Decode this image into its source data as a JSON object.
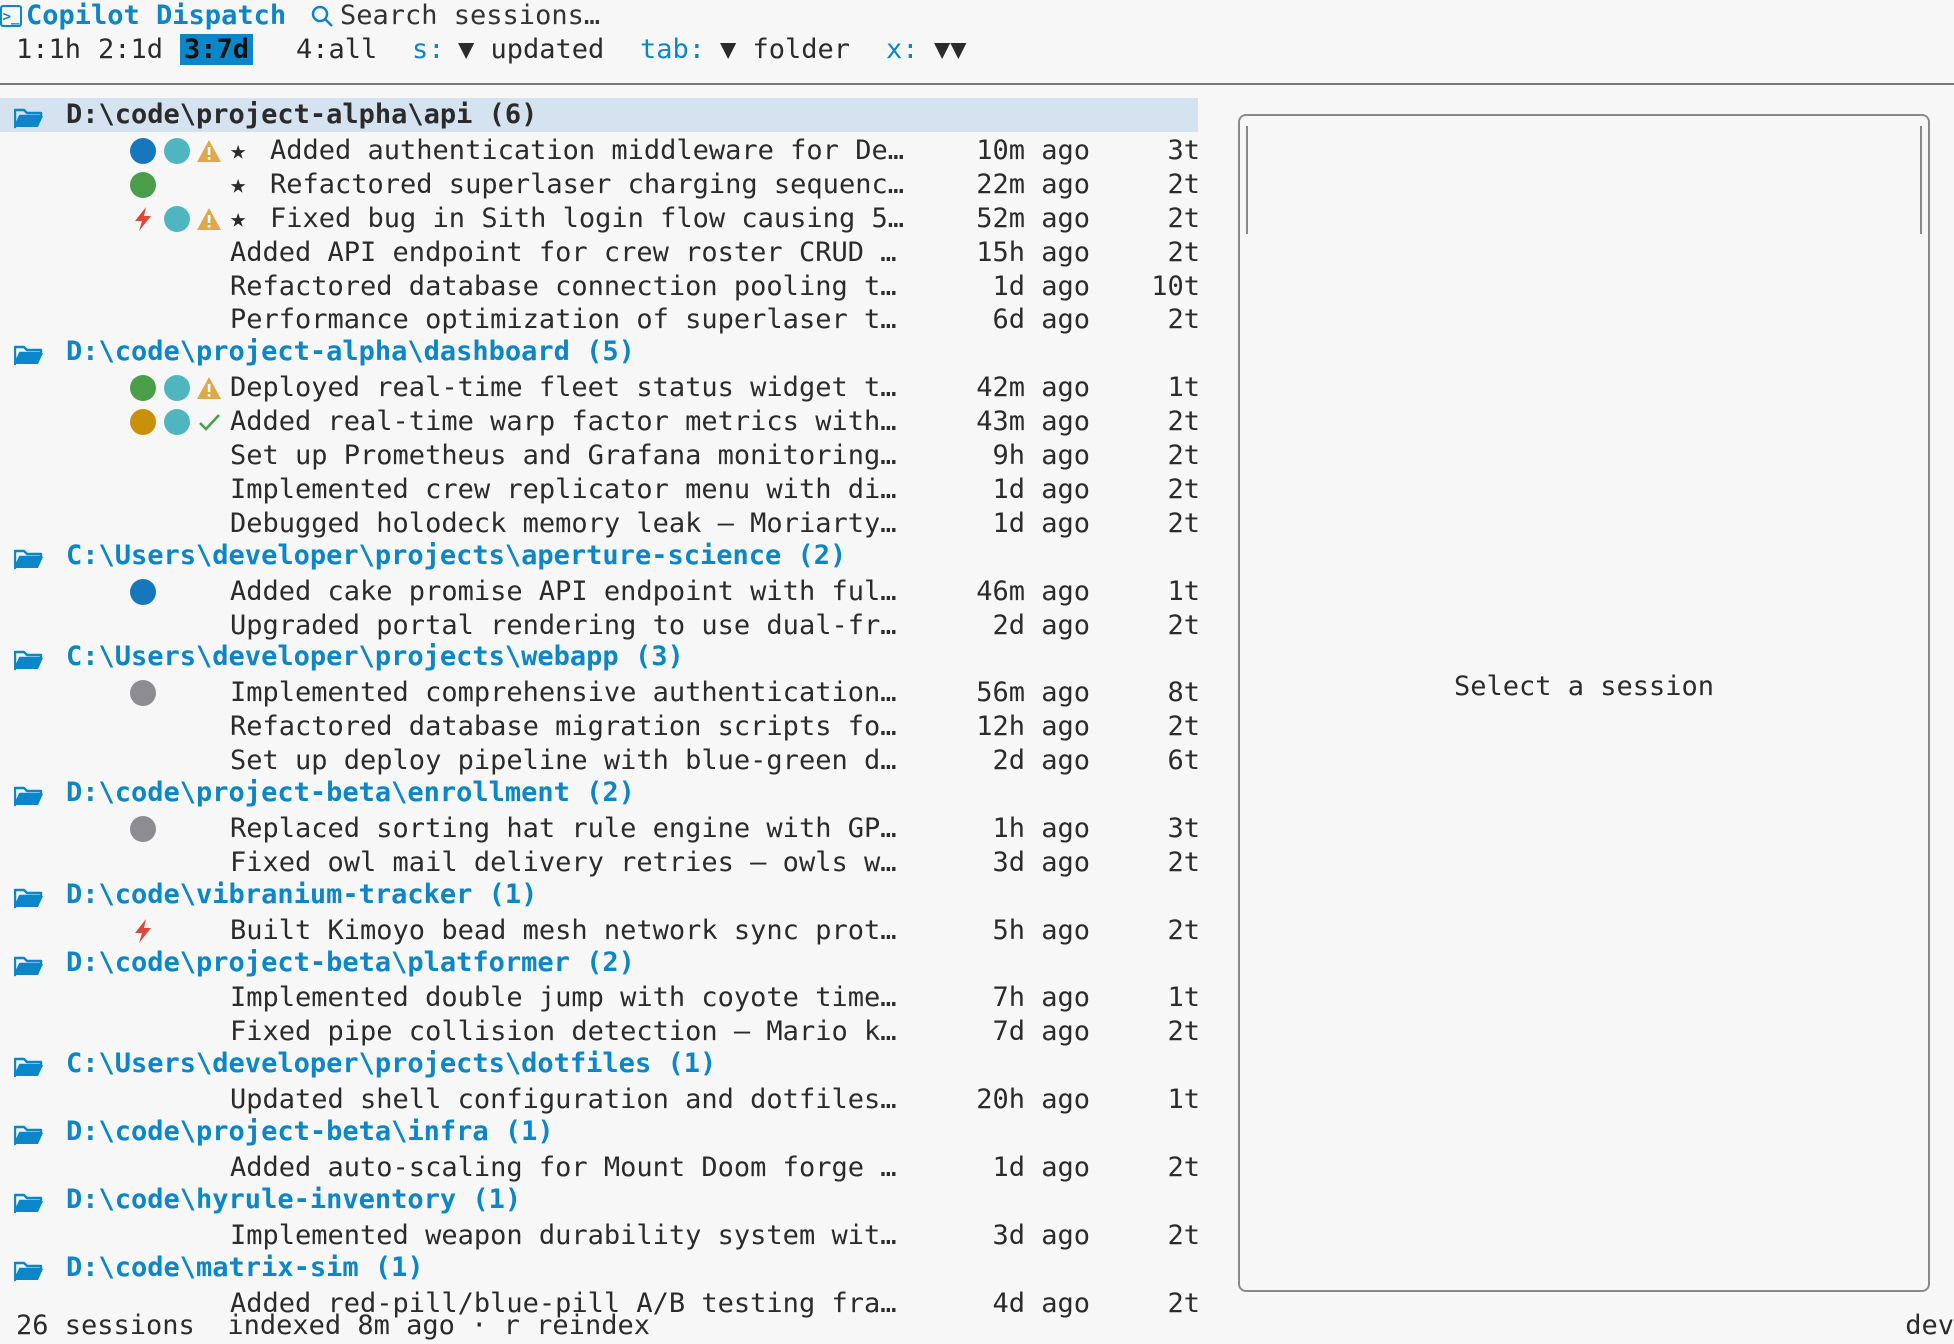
{
  "app": {
    "title": "Copilot Dispatch"
  },
  "search": {
    "placeholder": "Search sessions…"
  },
  "filters": {
    "time_tabs": [
      "1:1h",
      "2:1d",
      "3:7d",
      "4:all"
    ],
    "active_time_tab": "3:7d",
    "sort_label": "s:",
    "sort_value": "▼ updated",
    "tab_label": "tab:",
    "tab_value": "▼ folder",
    "x_label": "x:",
    "x_value": "▼▼"
  },
  "groups": [
    {
      "path": "D:\\code\\project-alpha\\api (6)",
      "selected": true,
      "sessions": [
        {
          "indicators": [
            "dot-blue",
            "dot-teal",
            "warn"
          ],
          "star": true,
          "title": "Added authentication middleware for De…",
          "time": "10m ago",
          "turns": "3t"
        },
        {
          "indicators": [
            "dot-green"
          ],
          "star": true,
          "title": "Refactored superlaser charging sequenc…",
          "time": "22m ago",
          "turns": "2t"
        },
        {
          "indicators": [
            "bolt",
            "dot-teal",
            "warn"
          ],
          "star": true,
          "title": "Fixed bug in Sith login flow causing 5…",
          "time": "52m ago",
          "turns": "2t"
        },
        {
          "indicators": [],
          "star": false,
          "title": "Added API endpoint for crew roster CRUD …",
          "time": "15h ago",
          "turns": "2t"
        },
        {
          "indicators": [],
          "star": false,
          "title": "Refactored database connection pooling t…",
          "time": "1d ago",
          "turns": "10t"
        },
        {
          "indicators": [],
          "star": false,
          "title": "Performance optimization of superlaser t…",
          "time": "6d ago",
          "turns": "2t"
        }
      ]
    },
    {
      "path": "D:\\code\\project-alpha\\dashboard (5)",
      "sessions": [
        {
          "indicators": [
            "dot-green",
            "dot-teal",
            "warn"
          ],
          "star": false,
          "title": "Deployed real-time fleet status widget t…",
          "time": "42m ago",
          "turns": "1t"
        },
        {
          "indicators": [
            "dot-amber",
            "dot-teal",
            "check"
          ],
          "star": false,
          "title": "Added real-time warp factor metrics with…",
          "time": "43m ago",
          "turns": "2t"
        },
        {
          "indicators": [],
          "star": false,
          "title": "Set up Prometheus and Grafana monitoring…",
          "time": "9h ago",
          "turns": "2t"
        },
        {
          "indicators": [],
          "star": false,
          "title": "Implemented crew replicator menu with di…",
          "time": "1d ago",
          "turns": "2t"
        },
        {
          "indicators": [],
          "star": false,
          "title": "Debugged holodeck memory leak — Moriarty…",
          "time": "1d ago",
          "turns": "2t"
        }
      ]
    },
    {
      "path": "C:\\Users\\developer\\projects\\aperture-science (2)",
      "sessions": [
        {
          "indicators": [
            "dot-blue"
          ],
          "star": false,
          "title": "Added cake promise API endpoint with ful…",
          "time": "46m ago",
          "turns": "1t"
        },
        {
          "indicators": [],
          "star": false,
          "title": "Upgraded portal rendering to use dual-fr…",
          "time": "2d ago",
          "turns": "2t"
        }
      ]
    },
    {
      "path": "C:\\Users\\developer\\projects\\webapp (3)",
      "sessions": [
        {
          "indicators": [
            "dot-gray"
          ],
          "star": false,
          "title": "Implemented comprehensive authentication…",
          "time": "56m ago",
          "turns": "8t"
        },
        {
          "indicators": [],
          "star": false,
          "title": "Refactored database migration scripts fo…",
          "time": "12h ago",
          "turns": "2t"
        },
        {
          "indicators": [],
          "star": false,
          "title": "Set up deploy pipeline with blue-green d…",
          "time": "2d ago",
          "turns": "6t"
        }
      ]
    },
    {
      "path": "D:\\code\\project-beta\\enrollment (2)",
      "sessions": [
        {
          "indicators": [
            "dot-gray"
          ],
          "star": false,
          "title": "Replaced sorting hat rule engine with GP…",
          "time": "1h ago",
          "turns": "3t"
        },
        {
          "indicators": [],
          "star": false,
          "title": "Fixed owl mail delivery retries — owls w…",
          "time": "3d ago",
          "turns": "2t"
        }
      ]
    },
    {
      "path": "D:\\code\\vibranium-tracker (1)",
      "sessions": [
        {
          "indicators": [
            "bolt"
          ],
          "star": false,
          "title": "Built Kimoyo bead mesh network sync prot…",
          "time": "5h ago",
          "turns": "2t"
        }
      ]
    },
    {
      "path": "D:\\code\\project-beta\\platformer (2)",
      "sessions": [
        {
          "indicators": [],
          "star": false,
          "title": "Implemented double jump with coyote time…",
          "time": "7h ago",
          "turns": "1t"
        },
        {
          "indicators": [],
          "star": false,
          "title": "Fixed pipe collision detection — Mario k…",
          "time": "7d ago",
          "turns": "2t"
        }
      ]
    },
    {
      "path": "C:\\Users\\developer\\projects\\dotfiles (1)",
      "sessions": [
        {
          "indicators": [],
          "star": false,
          "title": "Updated shell configuration and dotfiles…",
          "time": "20h ago",
          "turns": "1t"
        }
      ]
    },
    {
      "path": "D:\\code\\project-beta\\infra (1)",
      "sessions": [
        {
          "indicators": [],
          "star": false,
          "title": "Added auto-scaling for Mount Doom forge …",
          "time": "1d ago",
          "turns": "2t"
        }
      ]
    },
    {
      "path": "D:\\code\\hyrule-inventory (1)",
      "sessions": [
        {
          "indicators": [],
          "star": false,
          "title": "Implemented weapon durability system wit…",
          "time": "3d ago",
          "turns": "2t"
        }
      ]
    },
    {
      "path": "D:\\code\\matrix-sim (1)",
      "sessions": [
        {
          "indicators": [],
          "star": false,
          "title": "Added red-pill/blue-pill A/B testing fra…",
          "time": "4d ago",
          "turns": "2t"
        }
      ]
    }
  ],
  "preview": {
    "empty_message": "Select a session"
  },
  "status": {
    "left": "26 sessions  indexed 8m ago · r reindex",
    "right": "dev"
  },
  "colors": {
    "accent": "#0b86c8",
    "dot-blue": "#1677bd",
    "dot-teal": "#4fb6c0",
    "dot-green": "#4a9e4a",
    "dot-amber": "#c9900a",
    "dot-gray": "#8c8c91",
    "warn": "#e0a84a",
    "bolt": "#e0463a",
    "check": "#4a9e4a"
  }
}
